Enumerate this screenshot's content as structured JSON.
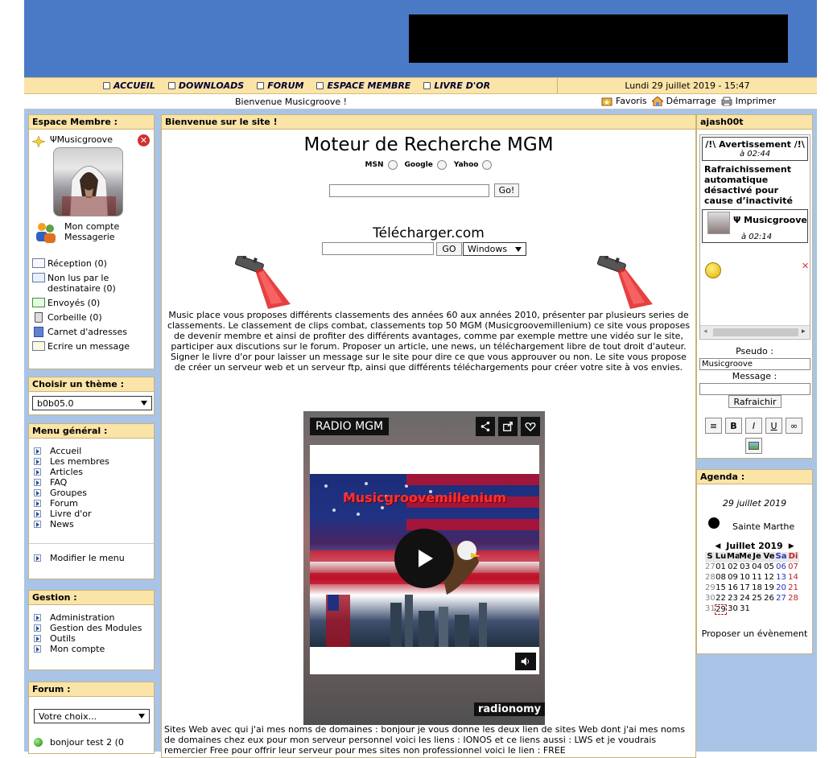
{
  "nav": {
    "links": [
      "ACCUEIL",
      "DOWNLOADS",
      "FORUM",
      "ESPACE MEMBRE",
      "LIVRE D'OR"
    ],
    "date": "Lundi 29 juillet 2019 - 15:47"
  },
  "welcome": {
    "message": "Bienvenue Musicgroove !",
    "favoris": "Favoris",
    "demarrage": "Démarrage",
    "imprimer": "Imprimer"
  },
  "espace_membre": {
    "title": "Espace Membre :",
    "username": "ΨMusicgroove",
    "mon_compte": "Mon compte",
    "messagerie": "Messagerie",
    "items": [
      "Réception (0)",
      "Non lus par le destinataire (0)",
      "Envoyés (0)",
      "Corbeille (0)",
      "Carnet d'adresses",
      "Ecrire un message"
    ]
  },
  "theme": {
    "title": "Choisir un thème :",
    "selected": "b0b05.0"
  },
  "menu_general": {
    "title": "Menu général :",
    "items": [
      "Accueil",
      "Les membres",
      "Articles",
      "FAQ",
      "Groupes",
      "Forum",
      "Livre d'or",
      "News"
    ],
    "modify": "Modifier le menu"
  },
  "gestion": {
    "title": "Gestion :",
    "items": [
      "Administration",
      "Gestion des Modules",
      "Outils",
      "Mon compte"
    ]
  },
  "forum": {
    "title": "Forum :",
    "select": "Votre choix...",
    "topic": "bonjour test 2 (0"
  },
  "center": {
    "title": "Bienvenue sur le site !",
    "search_title": "Moteur de Recherche MGM",
    "engines": [
      "MSN",
      "Google",
      "Yahoo"
    ],
    "go_button": "Go!",
    "telecharger_title": "Télécharger.com",
    "telecharger_go": "GO",
    "os_select": "Windows",
    "description": "Music place vous proposes différents classements des années 60 aux années 2010, présenter par plusieurs series de classements. Le classement de clips combat, classements top 50 MGM (Musicgroovemillenium) ce site vous proposes de devenir membre et ainsi de profiter des différents avantages, comme par exemple mettre une vidéo sur le site, participer aux discutions sur le forum. Proposer un article, une news, un téléchargement libre de tout droit d'auteur. Signer le livre d'or pour laisser un message sur le site pour dire ce que vous approuver ou non. Le site vous propose de créer un serveur web et un serveur ftp, ainsi que différents téléchargements pour créer votre site à vos envies.",
    "radio_title": "RADIO MGM",
    "radio_banner": "Musicgroovemillenium",
    "radio_brand": "radionomy",
    "footer_text": "Sites Web avec qui j'ai mes noms de domaines : bonjour je vous donne les deux lien de sites Web dont j'ai mes noms de domaines chez eux pour mon serveur personnel voici les liens : IONOS et ce liens aussi : LWS et je voudrais remercier Free pour offrir leur serveur pour mes sites non professionnel voici le lien : FREE"
  },
  "chat": {
    "title": "ajash00t",
    "msg1_title": "/!\\ Avertissement /!\\",
    "msg1_time": "à 02:44",
    "msg1_body": "Rafraichissement automatique désactivé pour cause d’inactivité",
    "msg2_user": "Ψ Musicgroove",
    "msg2_time": "à 02:14",
    "pseudo_label": "Pseudo :",
    "pseudo_value": "Musicgroove",
    "message_label": "Message :",
    "refresh_button": "Rafraichir",
    "format_buttons": [
      "B",
      "I",
      "U"
    ]
  },
  "agenda": {
    "title": "Agenda :",
    "date": "29 juillet 2019",
    "saint": "Sainte Marthe",
    "month": "Juillet 2019",
    "days": [
      "S",
      "Lu",
      "Ma",
      "Me",
      "Je",
      "Ve",
      "Sa",
      "Di"
    ],
    "weeks": [
      [
        "27",
        "01",
        "02",
        "03",
        "04",
        "05",
        "06",
        "07"
      ],
      [
        "28",
        "08",
        "09",
        "10",
        "11",
        "12",
        "13",
        "14"
      ],
      [
        "29",
        "15",
        "16",
        "17",
        "18",
        "19",
        "20",
        "21"
      ],
      [
        "30",
        "22",
        "23",
        "24",
        "25",
        "26",
        "27",
        "28"
      ],
      [
        "31",
        "29",
        "30",
        "31",
        "",
        "",
        "",
        ""
      ]
    ],
    "propose": "Proposer un évènement"
  }
}
